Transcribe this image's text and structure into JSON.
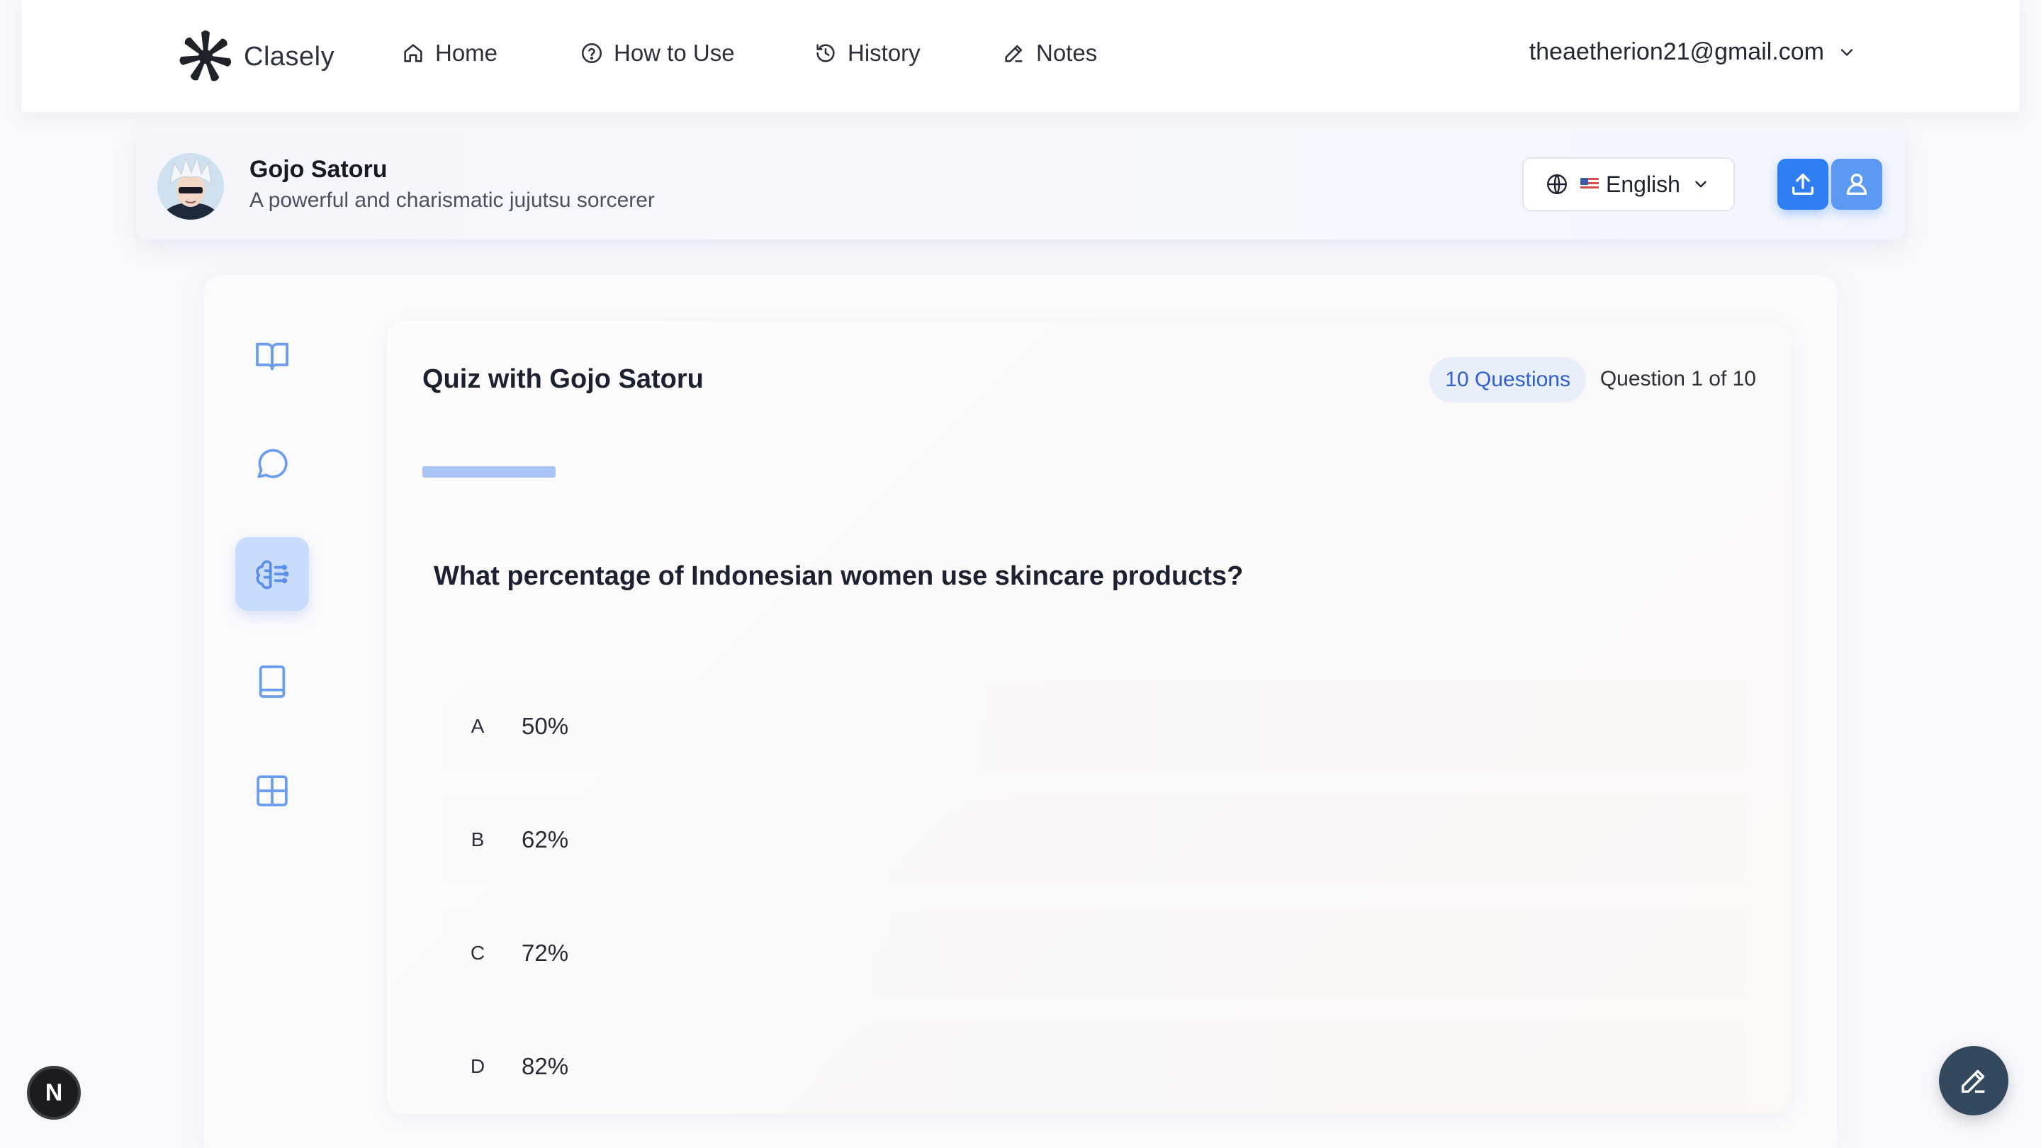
{
  "nav": {
    "brand": "Clasely",
    "links": [
      {
        "label": "Home",
        "icon": "home-icon"
      },
      {
        "label": "How to Use",
        "icon": "help-circle-icon"
      },
      {
        "label": "History",
        "icon": "history-icon"
      },
      {
        "label": "Notes",
        "icon": "pencil-icon"
      }
    ],
    "account_email": "theaetherion21@gmail.com"
  },
  "character": {
    "name": "Gojo Satoru",
    "description": "A powerful and charismatic jujutsu sorcerer",
    "language": "English"
  },
  "sidebar": {
    "items": [
      {
        "icon": "open-book-icon",
        "active": false
      },
      {
        "icon": "chat-bubble-icon",
        "active": false
      },
      {
        "icon": "brain-icon",
        "active": true
      },
      {
        "icon": "notebook-icon",
        "active": false
      },
      {
        "icon": "grid-icon",
        "active": false
      }
    ]
  },
  "quiz": {
    "title": "Quiz with Gojo Satoru",
    "questions_badge": "10 Questions",
    "position": "Question 1 of 10",
    "progress_fraction": 0.1,
    "question": "What percentage of Indonesian women use skincare products?",
    "options": [
      {
        "letter": "A",
        "text": "50%"
      },
      {
        "letter": "B",
        "text": "62%"
      },
      {
        "letter": "C",
        "text": "72%"
      },
      {
        "letter": "D",
        "text": "82%"
      }
    ]
  },
  "colors": {
    "accent": "#2f7ef3",
    "accent_light": "#5c99f2",
    "active_side": "#c9dcfb",
    "progress": "#a9c5f6",
    "fab": "#34495e"
  },
  "fab": {
    "dev_badge": "N"
  }
}
